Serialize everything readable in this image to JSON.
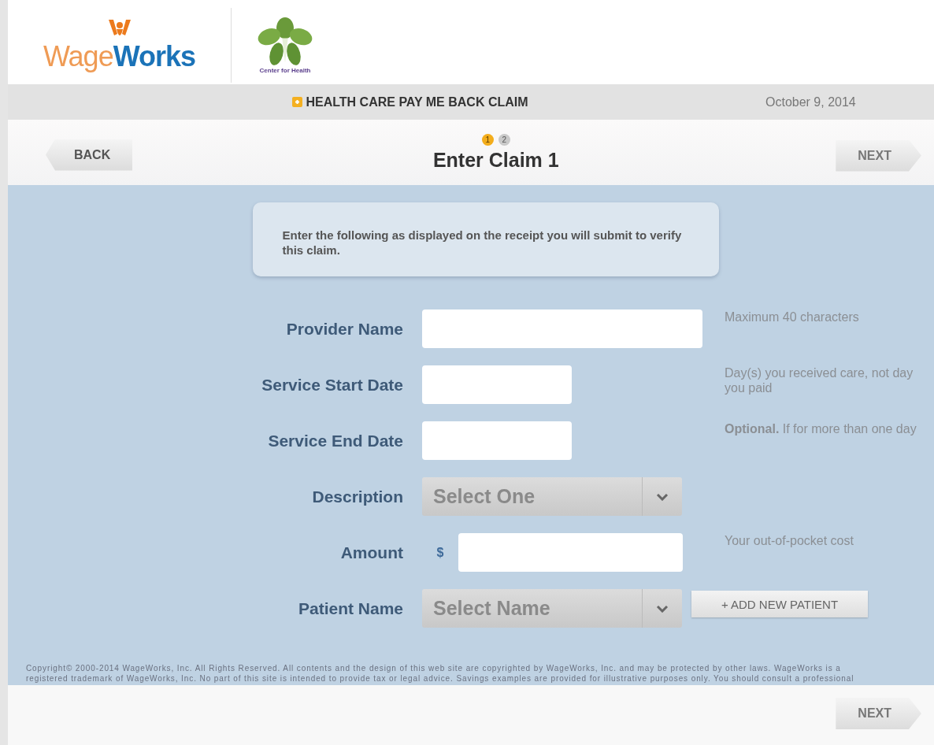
{
  "header": {
    "logo": {
      "part_1": "Wage",
      "part_2": "Works"
    },
    "partner_logo": {
      "caption": "Center for Health"
    }
  },
  "title_bar": {
    "title": "HEALTH CARE PAY ME BACK CLAIM",
    "date": "October 9, 2014"
  },
  "nav": {
    "back": "BACK",
    "next": "NEXT",
    "steps": [
      {
        "label": "1",
        "selected": true
      },
      {
        "label": "2",
        "selected": false
      }
    ],
    "heading": "Enter Claim 1"
  },
  "info": "Enter the following as displayed on the receipt you will submit to verify this claim.",
  "fields": [
    {
      "label": "Provider Name",
      "kind": "text",
      "hint": "Maximum 40 characters"
    },
    {
      "label": "Service Start Date",
      "kind": "date",
      "hint": "Day(s) you received care, not day you paid"
    },
    {
      "label": "Service End Date",
      "kind": "date",
      "hint": "**Optional.** If for more than one day"
    },
    {
      "label": "Description",
      "kind": "select",
      "placeholder": "Select One"
    },
    {
      "label": "Amount",
      "kind": "amount",
      "prefix": "$",
      "hint": "Your out-of-pocket cost"
    },
    {
      "label": "Patient Name",
      "kind": "select",
      "placeholder": "Select Name",
      "action": "+ ADD NEW PATIENT"
    }
  ],
  "footer": {
    "copyright": [
      "Copyright© 2000-2014 WageWorks, Inc. All Rights Reserved. All contents and the design of this web site are copyrighted by WageWorks, Inc. and may be protected by other laws. WageWorks is a",
      "registered trademark of WageWorks, Inc. No part of this site is intended to provide tax or legal advice. Savings examples are provided for illustrative purposes only. You should consult a professional"
    ],
    "next": "NEXT"
  }
}
